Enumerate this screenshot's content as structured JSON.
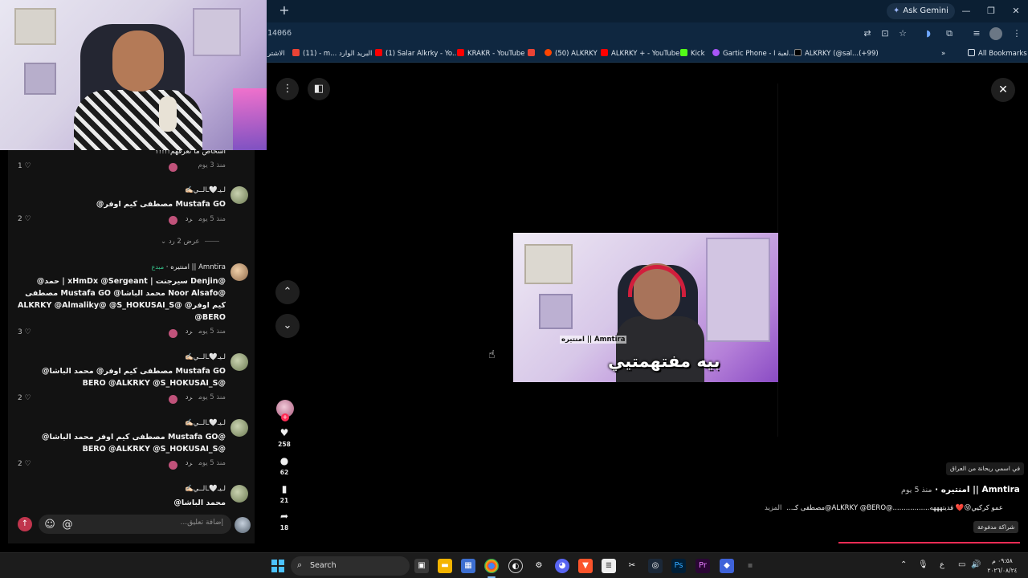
{
  "browser": {
    "new_tab_glyph": "+",
    "ask_gemini": "Ask Gemini",
    "url_fragment": "14066",
    "window_controls": [
      "—",
      "❐",
      "✕"
    ],
    "bookmarks": [
      {
        "label": "الاشتر",
        "color": "#ff6a00"
      },
      {
        "label": "(11) - m... البريد الوارد",
        "color": "#ea4335"
      },
      {
        "label": "(1) Salar Alkrky - Yo...",
        "color": "#ff0000"
      },
      {
        "label": "KRAKR - YouTube",
        "color": "#ff0000"
      },
      {
        "label": "",
        "color": "#ea4335"
      },
      {
        "label": "(50) ALKRKY",
        "color": "#ff4500"
      },
      {
        "label": "ALKRKY + - YouTube",
        "color": "#ff0000"
      },
      {
        "label": "Kick",
        "color": "#53fc18"
      },
      {
        "label": "Gartic Phone - لعبة ا...",
        "color": "#a855f7"
      },
      {
        "label": "ALKRKY (@sal...(+99)",
        "color": "#111111"
      }
    ],
    "all_bookmarks": "All Bookmarks",
    "more_bookmarks": "»"
  },
  "comments": {
    "top_partial_text": "اشخاص ما نعرفهم!!!!؟",
    "top_partial_meta": "منذ 3 يوم",
    "top_partial_likes": "1",
    "items": [
      {
        "name": "لـيـ🤍ـالــي✍🏻",
        "text": "Mustafa GO مصطفى كيم اوفر@",
        "age": "منذ 5 يوم",
        "reply": "رد",
        "likes": "2"
      },
      {
        "name": "Amntira || امنتيره",
        "badge": "مبدع",
        "text": "@Denjin سيرجنت | xHmDx @Sergeant | حمد@ @Noor Alsafo محمد الباشا@ Mustafa GO مصطفى كيم اوفر@ @ALKRKY @Almaliky@ @S_HOKUSAI_S @BERO",
        "age": "منذ 5 يوم",
        "reply": "رد",
        "likes": "3"
      },
      {
        "name": "لـيـ🤍ـالــي✍🏻",
        "text": "Mustafa GO مصطفى كيم اوفر@ محمد الباشا@ @BERO @ALKRKY @S_HOKUSAI_S",
        "age": "منذ 5 يوم",
        "reply": "رد",
        "likes": "2"
      },
      {
        "name": "لـيـ🤍ـالــي✍🏻",
        "text": "@Mustafa GO مصطفى كيم اوفر محمد الباشا@ @BERO @ALKRKY @S_HOKUSAI_S",
        "age": "منذ 5 يوم",
        "reply": "رد",
        "likes": "2"
      },
      {
        "name": "لـيـ🤍ـالــي✍🏻",
        "text": "محمد الباشا@",
        "age": "",
        "reply": "",
        "likes": ""
      }
    ],
    "view_replies": "عرض 2 رد",
    "input_placeholder": "إضافة تعليق...",
    "emoji_glyph": "☺",
    "at_glyph": "@",
    "send_glyph": "↑"
  },
  "video": {
    "caption_small": "امنتيره || Amntira",
    "caption_big": "بيه مفتهمتيي"
  },
  "actions": {
    "likes": "258",
    "comments": "62",
    "saves": "21",
    "shares": "18"
  },
  "post": {
    "music": "في اسمي ريحانة من العراق",
    "author": "Amntira || امنتيره",
    "age": "منذ 5 يوم",
    "description": "عمو كركيي😝❤️ فديتهههه.................@ALKRKY @BERO@مصطفى كـ...",
    "more": "المزيد",
    "paid_tag": "شراكة مدفوعة"
  },
  "taskbar": {
    "search_label": "Search",
    "lang": "ع",
    "time": "٠٩:٥٨ م",
    "date": "٢٠٢٦/٠٨/٢٤"
  }
}
